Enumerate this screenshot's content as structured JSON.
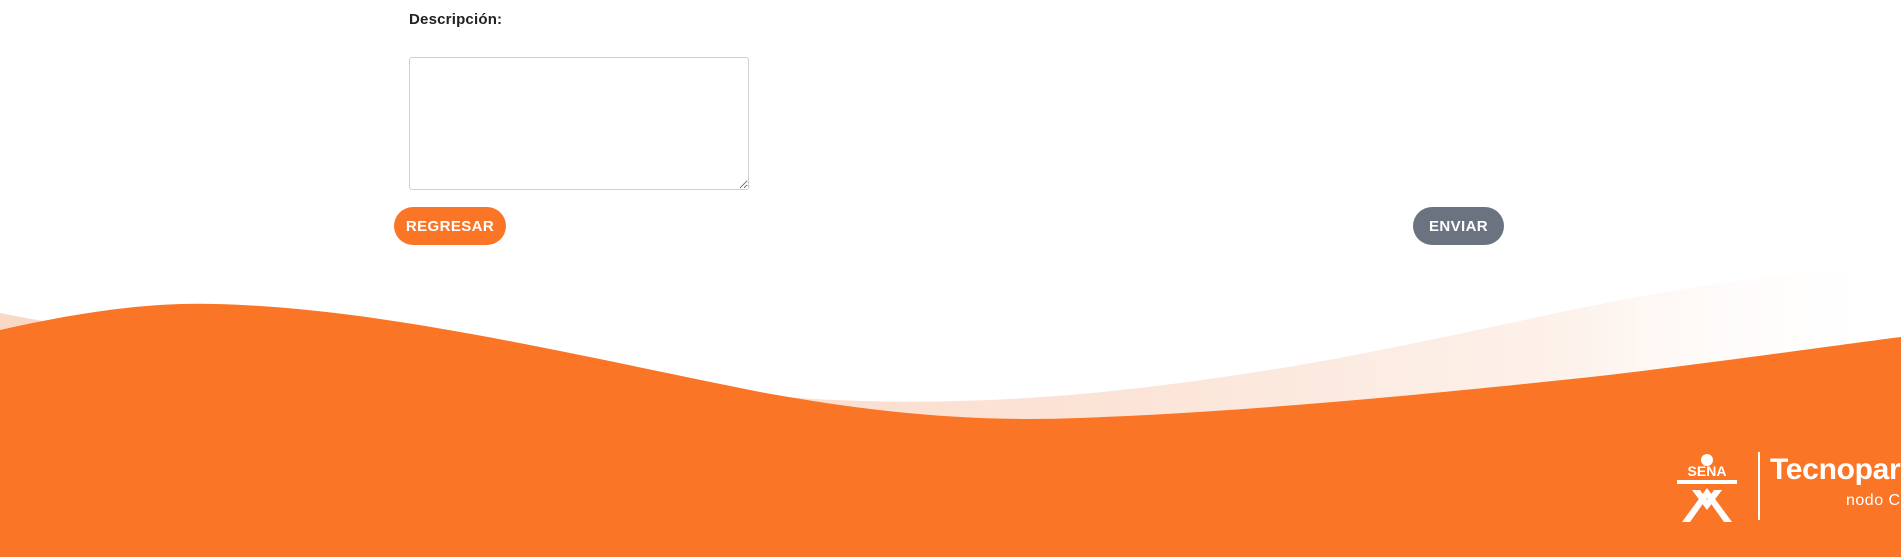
{
  "form": {
    "description_label": "Descripción:",
    "description_value": "",
    "back_button": "REGRESAR",
    "send_button": "ENVIAR"
  },
  "footer": {
    "logo_text": "SENA",
    "brand_name": "Tecnoparc",
    "brand_subtitle": "nodo  C"
  },
  "colors": {
    "accent": "#fa7526",
    "send_button": "#6c7380",
    "wave_light": "#fbe3d6"
  }
}
